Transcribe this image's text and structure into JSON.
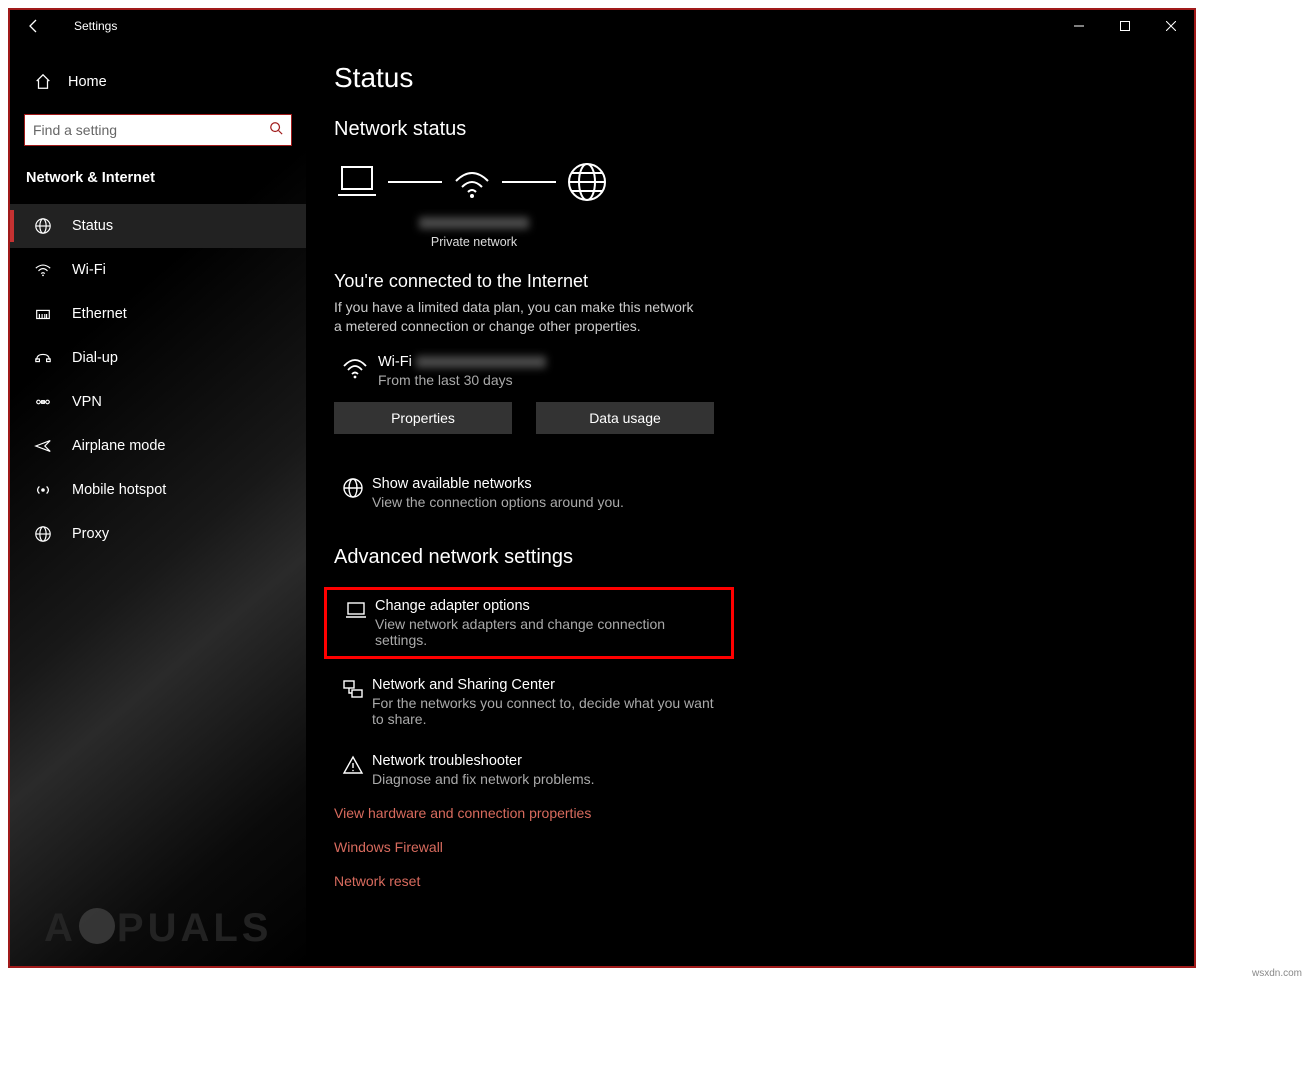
{
  "window": {
    "title": "Settings"
  },
  "sidebar": {
    "home": "Home",
    "search_placeholder": "Find a setting",
    "category": "Network & Internet",
    "items": [
      {
        "label": "Status",
        "active": true
      },
      {
        "label": "Wi-Fi"
      },
      {
        "label": "Ethernet"
      },
      {
        "label": "Dial-up"
      },
      {
        "label": "VPN"
      },
      {
        "label": "Airplane mode"
      },
      {
        "label": "Mobile hotspot"
      },
      {
        "label": "Proxy"
      }
    ]
  },
  "content": {
    "page_title": "Status",
    "network_status_heading": "Network status",
    "diagram_caption": "Private network",
    "connected_heading": "You're connected to the Internet",
    "connected_desc": "If you have a limited data plan, you can make this network a metered connection or change other properties.",
    "wifi_label": "Wi-Fi",
    "wifi_sub": "From the last 30 days",
    "btn_properties": "Properties",
    "btn_datausage": "Data usage",
    "show_networks_title": "Show available networks",
    "show_networks_desc": "View the connection options around you.",
    "advanced_heading": "Advanced network settings",
    "adapter_title": "Change adapter options",
    "adapter_desc": "View network adapters and change connection settings.",
    "sharing_title": "Network and Sharing Center",
    "sharing_desc": "For the networks you connect to, decide what you want to share.",
    "troubleshoot_title": "Network troubleshooter",
    "troubleshoot_desc": "Diagnose and fix network problems.",
    "link_hardware": "View hardware and connection properties",
    "link_firewall": "Windows Firewall",
    "link_reset": "Network reset"
  },
  "corner_watermark": "wsxdn.com"
}
